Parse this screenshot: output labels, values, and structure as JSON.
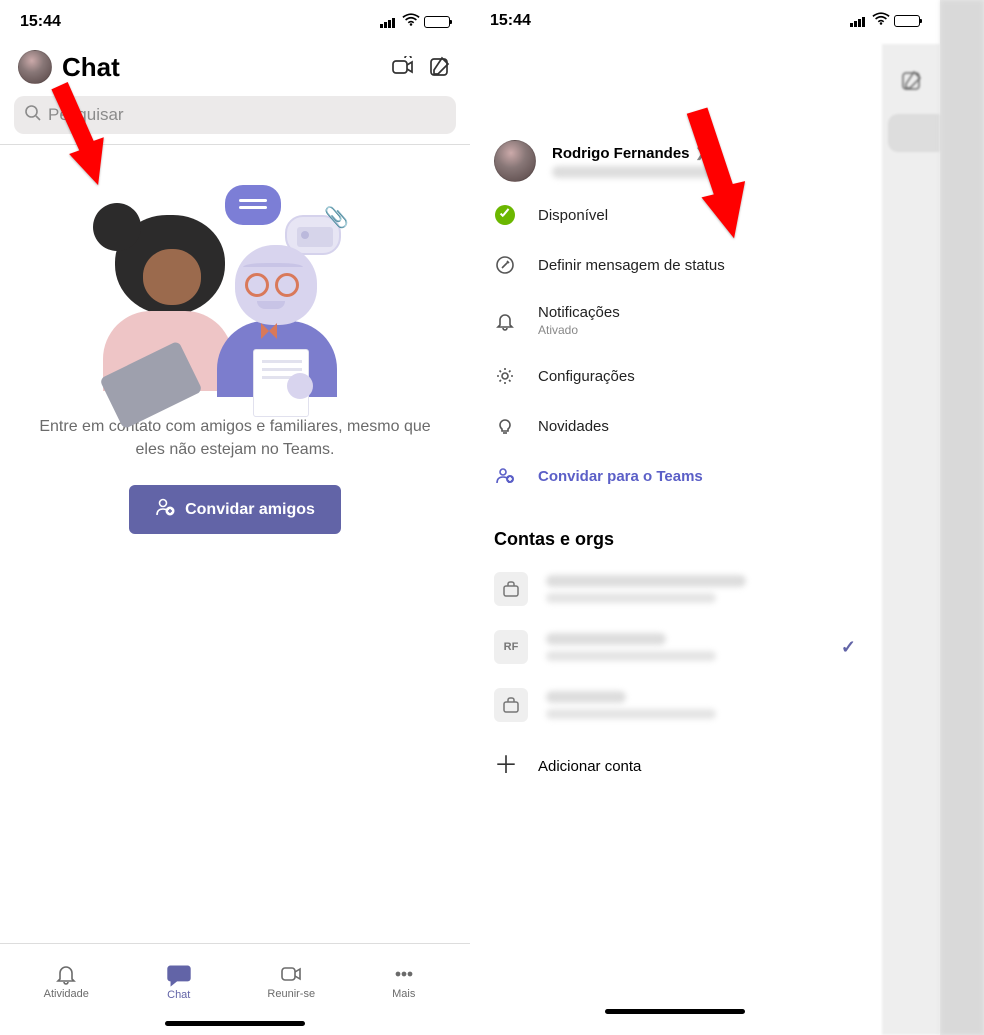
{
  "statusbar": {
    "time": "15:44"
  },
  "left": {
    "title": "Chat",
    "search_placeholder": "Pesquisar",
    "empty_text": "Entre em contato com amigos e familiares, mesmo que eles não estejam no Teams.",
    "invite_button": "Convidar amigos",
    "tabs": {
      "activity": "Atividade",
      "chat": "Chat",
      "meet": "Reunir-se",
      "more": "Mais"
    }
  },
  "right": {
    "profile_name": "Rodrigo Fernandes",
    "items": {
      "available": "Disponível",
      "status_msg": "Definir mensagem de status",
      "notifications_label": "Notificações",
      "notifications_sub": "Ativado",
      "settings": "Configurações",
      "whatsnew": "Novidades",
      "invite_teams": "Convidar para o Teams"
    },
    "accounts_header": "Contas e orgs",
    "account2_initials": "RF",
    "add_account": "Adicionar conta"
  }
}
